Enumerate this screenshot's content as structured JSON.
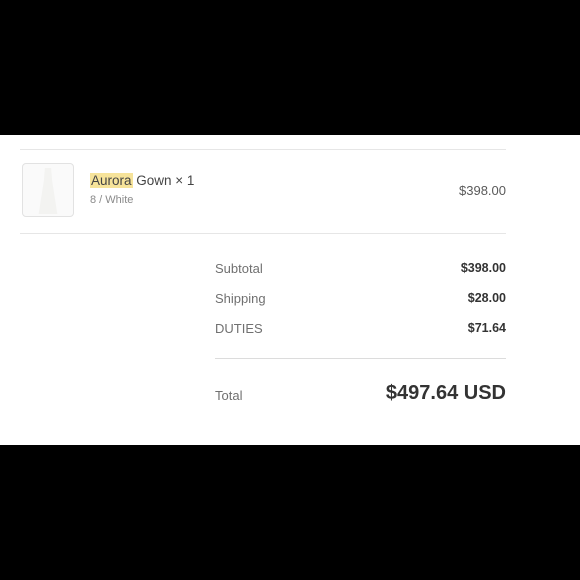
{
  "item": {
    "name_highlight": "Aurora",
    "name_rest": " Gown × 1",
    "variant": "8 / White",
    "price": "$398.00",
    "thumbnail_icon": "gown-thumbnail-icon"
  },
  "summary": [
    {
      "label": "Subtotal",
      "value": "$398.00"
    },
    {
      "label": "Shipping",
      "value": "$28.00"
    },
    {
      "label": "DUTIES",
      "value": "$71.64"
    }
  ],
  "total": {
    "label": "Total",
    "value": "$497.64 USD"
  },
  "colors": {
    "highlight": "#f6e39a",
    "background": "#ffffff",
    "letterbox": "#000000"
  }
}
